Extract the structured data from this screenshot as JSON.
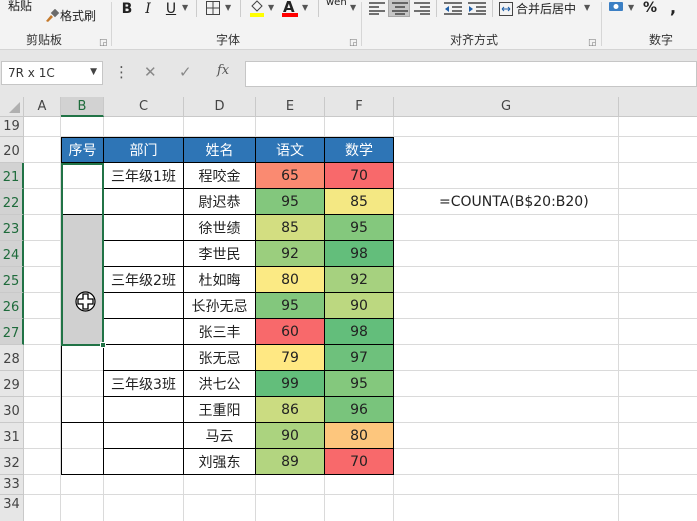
{
  "ribbon": {
    "clipboard_top": "粘贴",
    "format_painter": "格式刷",
    "bold": "B",
    "italic": "I",
    "underline": "U",
    "phonetic": "wén",
    "merge_center": "合并后居中",
    "percent": "%",
    "comma": ",",
    "groups": {
      "clipboard": "剪贴板",
      "font": "字体",
      "alignment": "对齐方式",
      "number": "数字"
    },
    "colors": {
      "fill": "#ffff00",
      "font": "#ff0000"
    }
  },
  "formula_bar": {
    "name_box": "7R x 1C",
    "more": "⋮",
    "cancel": "✕",
    "enter": "✓",
    "fx": "fx",
    "content": ""
  },
  "columns": [
    "A",
    "B",
    "C",
    "D",
    "E",
    "F",
    "G"
  ],
  "rows": [
    "19",
    "20",
    "21",
    "22",
    "23",
    "24",
    "25",
    "26",
    "27",
    "28",
    "29",
    "30",
    "31",
    "32",
    "33",
    "34"
  ],
  "table": {
    "headers": [
      "序号",
      "部门",
      "姓名",
      "语文",
      "数学"
    ],
    "departments": [
      "三年级1班",
      "三年级2班",
      "三年级3班"
    ],
    "records": [
      {
        "name": "程咬金",
        "chinese": "65",
        "math": "70"
      },
      {
        "name": "尉迟恭",
        "chinese": "95",
        "math": "85"
      },
      {
        "name": "徐世绩",
        "chinese": "85",
        "math": "95"
      },
      {
        "name": "李世民",
        "chinese": "92",
        "math": "98"
      },
      {
        "name": "杜如晦",
        "chinese": "80",
        "math": "92"
      },
      {
        "name": "长孙无忌",
        "chinese": "95",
        "math": "90"
      },
      {
        "name": "张三丰",
        "chinese": "60",
        "math": "98"
      },
      {
        "name": "张无忌",
        "chinese": "79",
        "math": "97"
      },
      {
        "name": "洪七公",
        "chinese": "99",
        "math": "95"
      },
      {
        "name": "王重阳",
        "chinese": "86",
        "math": "96"
      },
      {
        "name": "马云",
        "chinese": "90",
        "math": "80"
      },
      {
        "name": "刘强东",
        "chinese": "89",
        "math": "70"
      }
    ],
    "header_color": "#2e75b6",
    "scale_colors": {
      "low": "#f8696b",
      "mid": "#ffeb84",
      "high": "#63be7b"
    }
  },
  "formula_text": "=COUNTA(B$20:B20)"
}
